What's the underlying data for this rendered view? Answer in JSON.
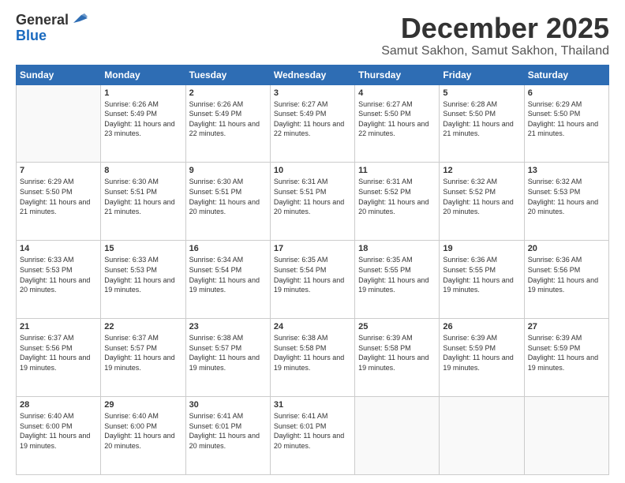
{
  "header": {
    "logo_general": "General",
    "logo_blue": "Blue",
    "month_title": "December 2025",
    "subtitle": "Samut Sakhon, Samut Sakhon, Thailand"
  },
  "calendar": {
    "days_of_week": [
      "Sunday",
      "Monday",
      "Tuesday",
      "Wednesday",
      "Thursday",
      "Friday",
      "Saturday"
    ],
    "weeks": [
      [
        {
          "day": "",
          "info": ""
        },
        {
          "day": "1",
          "info": "Sunrise: 6:26 AM\nSunset: 5:49 PM\nDaylight: 11 hours\nand 23 minutes."
        },
        {
          "day": "2",
          "info": "Sunrise: 6:26 AM\nSunset: 5:49 PM\nDaylight: 11 hours\nand 22 minutes."
        },
        {
          "day": "3",
          "info": "Sunrise: 6:27 AM\nSunset: 5:49 PM\nDaylight: 11 hours\nand 22 minutes."
        },
        {
          "day": "4",
          "info": "Sunrise: 6:27 AM\nSunset: 5:50 PM\nDaylight: 11 hours\nand 22 minutes."
        },
        {
          "day": "5",
          "info": "Sunrise: 6:28 AM\nSunset: 5:50 PM\nDaylight: 11 hours\nand 21 minutes."
        },
        {
          "day": "6",
          "info": "Sunrise: 6:29 AM\nSunset: 5:50 PM\nDaylight: 11 hours\nand 21 minutes."
        }
      ],
      [
        {
          "day": "7",
          "info": "Sunrise: 6:29 AM\nSunset: 5:50 PM\nDaylight: 11 hours\nand 21 minutes."
        },
        {
          "day": "8",
          "info": "Sunrise: 6:30 AM\nSunset: 5:51 PM\nDaylight: 11 hours\nand 21 minutes."
        },
        {
          "day": "9",
          "info": "Sunrise: 6:30 AM\nSunset: 5:51 PM\nDaylight: 11 hours\nand 20 minutes."
        },
        {
          "day": "10",
          "info": "Sunrise: 6:31 AM\nSunset: 5:51 PM\nDaylight: 11 hours\nand 20 minutes."
        },
        {
          "day": "11",
          "info": "Sunrise: 6:31 AM\nSunset: 5:52 PM\nDaylight: 11 hours\nand 20 minutes."
        },
        {
          "day": "12",
          "info": "Sunrise: 6:32 AM\nSunset: 5:52 PM\nDaylight: 11 hours\nand 20 minutes."
        },
        {
          "day": "13",
          "info": "Sunrise: 6:32 AM\nSunset: 5:53 PM\nDaylight: 11 hours\nand 20 minutes."
        }
      ],
      [
        {
          "day": "14",
          "info": "Sunrise: 6:33 AM\nSunset: 5:53 PM\nDaylight: 11 hours\nand 20 minutes."
        },
        {
          "day": "15",
          "info": "Sunrise: 6:33 AM\nSunset: 5:53 PM\nDaylight: 11 hours\nand 19 minutes."
        },
        {
          "day": "16",
          "info": "Sunrise: 6:34 AM\nSunset: 5:54 PM\nDaylight: 11 hours\nand 19 minutes."
        },
        {
          "day": "17",
          "info": "Sunrise: 6:35 AM\nSunset: 5:54 PM\nDaylight: 11 hours\nand 19 minutes."
        },
        {
          "day": "18",
          "info": "Sunrise: 6:35 AM\nSunset: 5:55 PM\nDaylight: 11 hours\nand 19 minutes."
        },
        {
          "day": "19",
          "info": "Sunrise: 6:36 AM\nSunset: 5:55 PM\nDaylight: 11 hours\nand 19 minutes."
        },
        {
          "day": "20",
          "info": "Sunrise: 6:36 AM\nSunset: 5:56 PM\nDaylight: 11 hours\nand 19 minutes."
        }
      ],
      [
        {
          "day": "21",
          "info": "Sunrise: 6:37 AM\nSunset: 5:56 PM\nDaylight: 11 hours\nand 19 minutes."
        },
        {
          "day": "22",
          "info": "Sunrise: 6:37 AM\nSunset: 5:57 PM\nDaylight: 11 hours\nand 19 minutes."
        },
        {
          "day": "23",
          "info": "Sunrise: 6:38 AM\nSunset: 5:57 PM\nDaylight: 11 hours\nand 19 minutes."
        },
        {
          "day": "24",
          "info": "Sunrise: 6:38 AM\nSunset: 5:58 PM\nDaylight: 11 hours\nand 19 minutes."
        },
        {
          "day": "25",
          "info": "Sunrise: 6:39 AM\nSunset: 5:58 PM\nDaylight: 11 hours\nand 19 minutes."
        },
        {
          "day": "26",
          "info": "Sunrise: 6:39 AM\nSunset: 5:59 PM\nDaylight: 11 hours\nand 19 minutes."
        },
        {
          "day": "27",
          "info": "Sunrise: 6:39 AM\nSunset: 5:59 PM\nDaylight: 11 hours\nand 19 minutes."
        }
      ],
      [
        {
          "day": "28",
          "info": "Sunrise: 6:40 AM\nSunset: 6:00 PM\nDaylight: 11 hours\nand 19 minutes."
        },
        {
          "day": "29",
          "info": "Sunrise: 6:40 AM\nSunset: 6:00 PM\nDaylight: 11 hours\nand 20 minutes."
        },
        {
          "day": "30",
          "info": "Sunrise: 6:41 AM\nSunset: 6:01 PM\nDaylight: 11 hours\nand 20 minutes."
        },
        {
          "day": "31",
          "info": "Sunrise: 6:41 AM\nSunset: 6:01 PM\nDaylight: 11 hours\nand 20 minutes."
        },
        {
          "day": "",
          "info": ""
        },
        {
          "day": "",
          "info": ""
        },
        {
          "day": "",
          "info": ""
        }
      ]
    ]
  }
}
